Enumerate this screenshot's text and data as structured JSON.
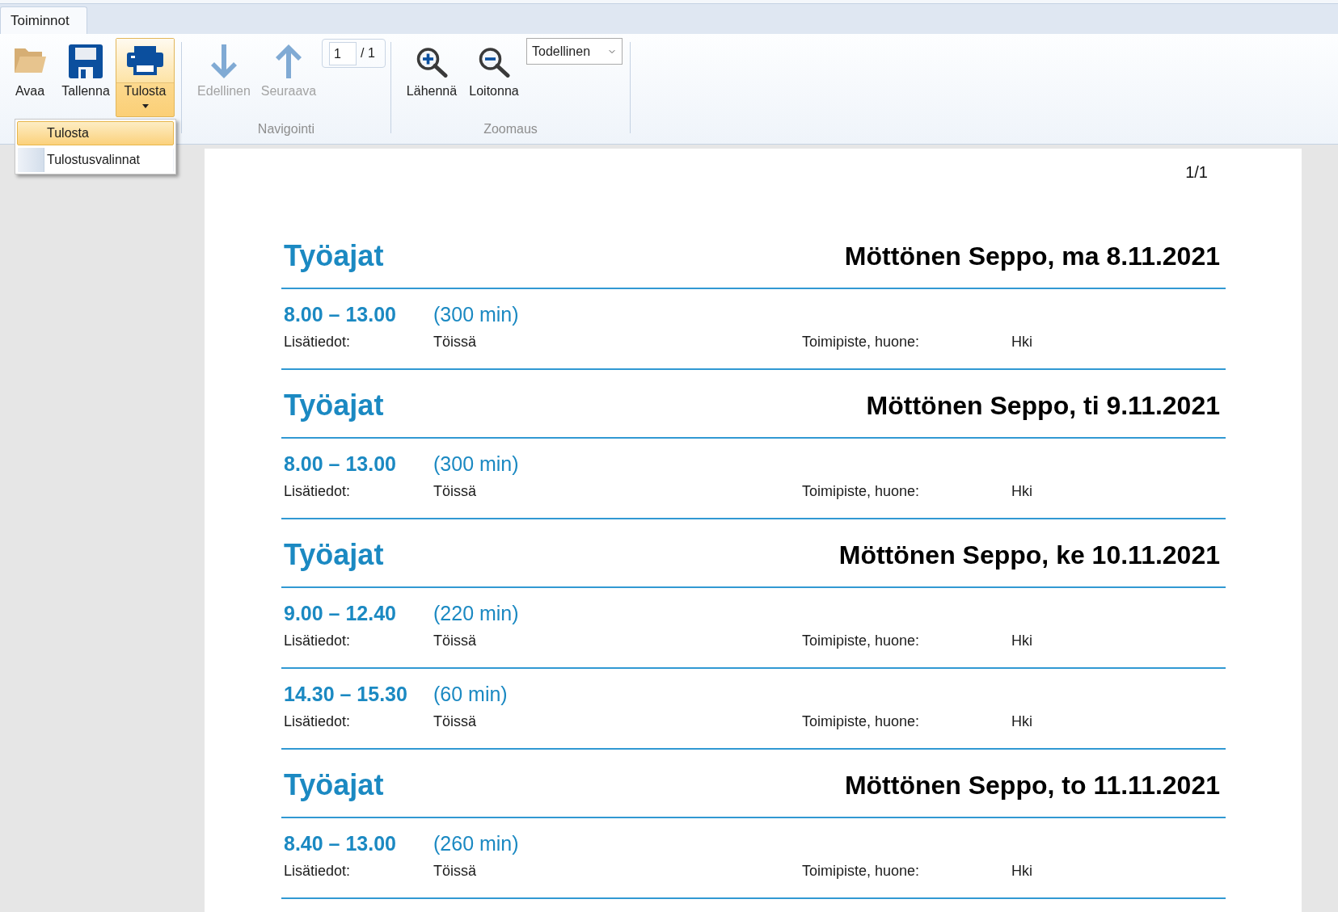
{
  "ribbon": {
    "tabs": [
      {
        "label": "Toiminnot",
        "selected": true
      }
    ],
    "file_group": {
      "buttons": [
        {
          "kind": "open",
          "label": "Avaa",
          "pressed": false,
          "has_menu": false
        },
        {
          "kind": "save",
          "label": "Tallenna",
          "pressed": false,
          "has_menu": false
        },
        {
          "kind": "print",
          "label": "Tulosta",
          "pressed": true,
          "has_menu": true
        }
      ]
    },
    "navigation_group": {
      "label": "Navigointi",
      "buttons": [
        {
          "kind": "previous",
          "label": "Edellinen",
          "disabled": true
        },
        {
          "kind": "next",
          "label": "Seuraava",
          "disabled": true
        }
      ],
      "page_field": {
        "value": "1",
        "total": "/ 1"
      }
    },
    "zoom_group": {
      "label": "Zoomaus",
      "buttons": [
        {
          "kind": "zoom_in",
          "label": "Lähennä",
          "disabled": false
        },
        {
          "kind": "zoom_out",
          "label": "Loitonna",
          "disabled": false
        }
      ],
      "zoom_select": {
        "value": "Todellinen"
      }
    }
  },
  "print_menu": {
    "items": [
      {
        "label": "Tulosta",
        "selected": true
      },
      {
        "label": "Tulostusvalinnat",
        "selected": false
      }
    ]
  },
  "document": {
    "page_number": "1/1",
    "days": [
      {
        "title": "Työajat",
        "heading": "Möttönen Seppo, ma 8.11.2021",
        "entries": [
          {
            "time": "8.00 – 13.00",
            "duration": "(300 min)",
            "details_label": "Lisätiedot:",
            "details": "Töissä",
            "location_label": "Toimipiste, huone:",
            "location": "Hki"
          }
        ]
      },
      {
        "title": "Työajat",
        "heading": "Möttönen Seppo, ti 9.11.2021",
        "entries": [
          {
            "time": "8.00 – 13.00",
            "duration": "(300 min)",
            "details_label": "Lisätiedot:",
            "details": "Töissä",
            "location_label": "Toimipiste, huone:",
            "location": "Hki"
          }
        ]
      },
      {
        "title": "Työajat",
        "heading": "Möttönen Seppo, ke 10.11.2021",
        "entries": [
          {
            "time": "9.00 – 12.40",
            "duration": "(220 min)",
            "details_label": "Lisätiedot:",
            "details": "Töissä",
            "location_label": "Toimipiste, huone:",
            "location": "Hki"
          },
          {
            "time": "14.30 – 15.30",
            "duration": "(60 min)",
            "details_label": "Lisätiedot:",
            "details": "Töissä",
            "location_label": "Toimipiste, huone:",
            "location": "Hki"
          }
        ]
      },
      {
        "title": "Työajat",
        "heading": "Möttönen Seppo, to 11.11.2021",
        "entries": [
          {
            "time": "8.40 – 13.00",
            "duration": "(260 min)",
            "details_label": "Lisätiedot:",
            "details": "Töissä",
            "location_label": "Toimipiste, huone:",
            "location": "Hki"
          }
        ]
      }
    ]
  }
}
